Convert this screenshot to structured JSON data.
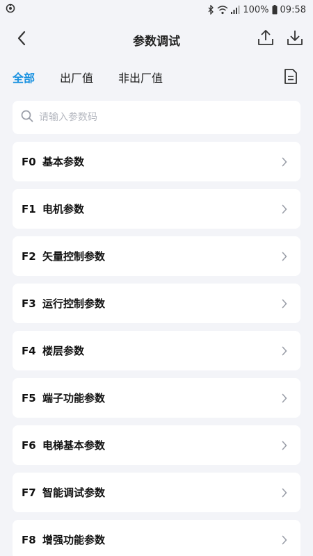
{
  "status_bar": {
    "battery": "100%",
    "time": "09:58"
  },
  "header": {
    "title": "参数调试"
  },
  "tabs": [
    {
      "label": "全部",
      "active": true
    },
    {
      "label": "出厂值",
      "active": false
    },
    {
      "label": "非出厂值",
      "active": false
    }
  ],
  "search": {
    "placeholder": "请输入参数码"
  },
  "groups": [
    {
      "code": "F0",
      "name": "基本参数"
    },
    {
      "code": "F1",
      "name": "电机参数"
    },
    {
      "code": "F2",
      "name": "矢量控制参数"
    },
    {
      "code": "F3",
      "name": "运行控制参数"
    },
    {
      "code": "F4",
      "name": "楼层参数"
    },
    {
      "code": "F5",
      "name": "端子功能参数"
    },
    {
      "code": "F6",
      "name": "电梯基本参数"
    },
    {
      "code": "F7",
      "name": "智能调试参数"
    },
    {
      "code": "F8",
      "name": "增强功能参数"
    }
  ],
  "colors": {
    "accent": "#1690e0",
    "background": "#f3f4f8",
    "card": "#ffffff"
  }
}
